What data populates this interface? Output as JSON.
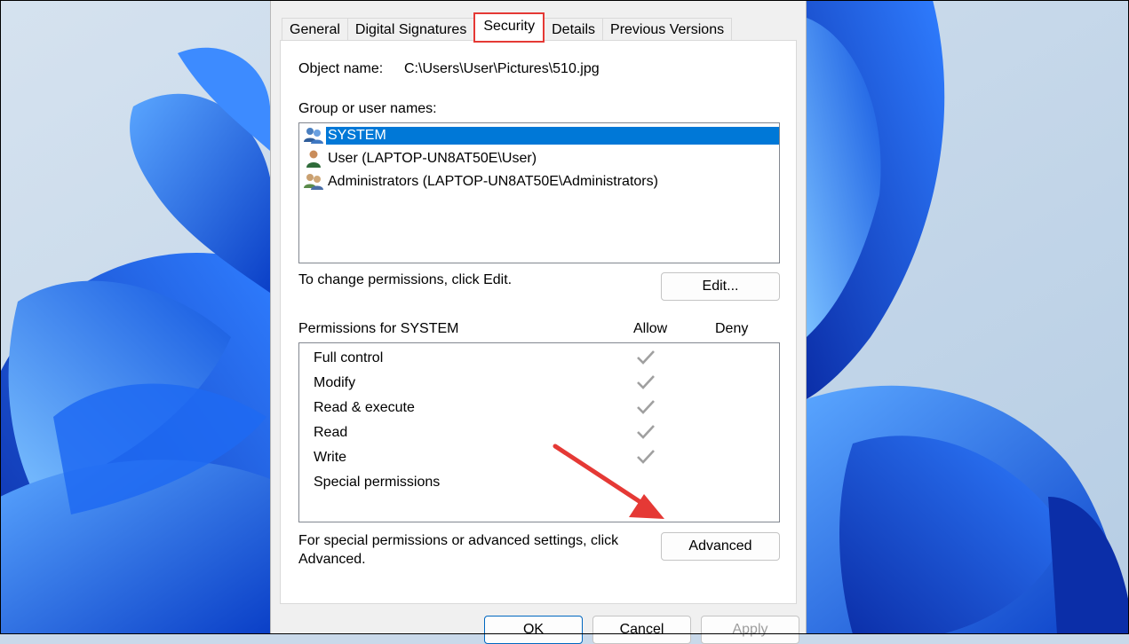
{
  "tabs": [
    {
      "label": "General",
      "active": false
    },
    {
      "label": "Digital Signatures",
      "active": false
    },
    {
      "label": "Security",
      "active": true
    },
    {
      "label": "Details",
      "active": false
    },
    {
      "label": "Previous Versions",
      "active": false
    }
  ],
  "object": {
    "label": "Object name:",
    "value": "C:\\Users\\User\\Pictures\\510.jpg"
  },
  "group_list": {
    "label": "Group or user names:",
    "items": [
      {
        "label": "SYSTEM",
        "icon": "system-group-icon",
        "selected": true
      },
      {
        "label": "User (LAPTOP-UN8AT50E\\User)",
        "icon": "user-icon",
        "selected": false
      },
      {
        "label": "Administrators (LAPTOP-UN8AT50E\\Administrators)",
        "icon": "admin-group-icon",
        "selected": false
      }
    ]
  },
  "edit": {
    "hint": "To change permissions, click Edit.",
    "button": "Edit..."
  },
  "permissions": {
    "title": "Permissions for SYSTEM",
    "allow_header": "Allow",
    "deny_header": "Deny",
    "rows": [
      {
        "name": "Full control",
        "allow": true,
        "deny": false
      },
      {
        "name": "Modify",
        "allow": true,
        "deny": false
      },
      {
        "name": "Read & execute",
        "allow": true,
        "deny": false
      },
      {
        "name": "Read",
        "allow": true,
        "deny": false
      },
      {
        "name": "Write",
        "allow": true,
        "deny": false
      },
      {
        "name": "Special permissions",
        "allow": false,
        "deny": false
      }
    ]
  },
  "advanced": {
    "hint_line1": "For special permissions or advanced settings, click",
    "hint_line2": "Advanced.",
    "button": "Advanced"
  },
  "footer": {
    "ok": "OK",
    "cancel": "Cancel",
    "apply": "Apply"
  },
  "colors": {
    "accent": "#0078d7",
    "highlight": "#e53935",
    "check": "#a0a0a0"
  }
}
